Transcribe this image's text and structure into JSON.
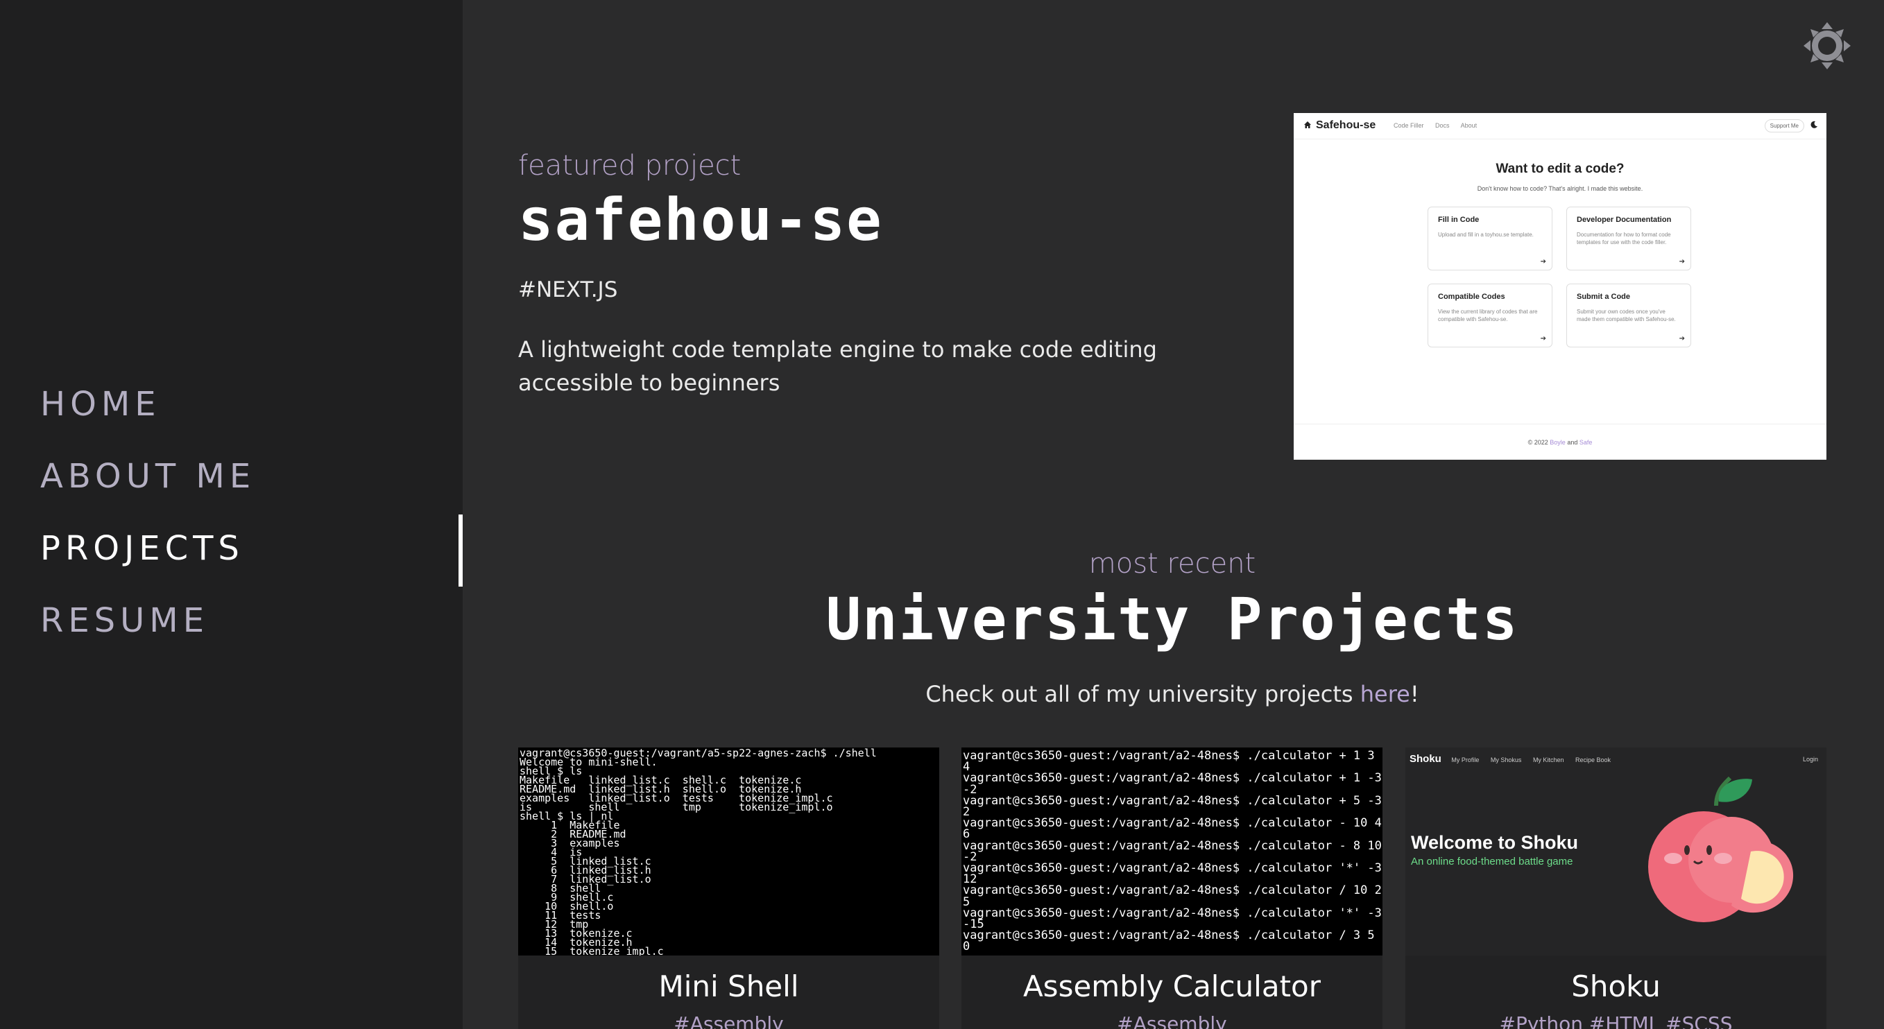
{
  "sidebar": {
    "items": [
      {
        "label": "HOME"
      },
      {
        "label": "ABOUT ME"
      },
      {
        "label": "PROJECTS"
      },
      {
        "label": "RESUME"
      }
    ],
    "active": "PROJECTS"
  },
  "theme_toggle": {
    "icon": "sun-icon"
  },
  "featured": {
    "eyebrow": "featured project",
    "title": "safehou-se",
    "tag": "#NEXT.JS",
    "description": "A lightweight code template engine to make code editing accessible to beginners",
    "screenshot": {
      "brand": "Safehou-se",
      "links": [
        "Code Filler",
        "Docs",
        "About"
      ],
      "support": "Support Me",
      "heading": "Want to edit a code?",
      "sub": "Don't know how to code? That's alright. I made this website.",
      "cards": [
        {
          "title": "Fill in Code",
          "body": "Upload and fill in a toyhou.se template."
        },
        {
          "title": "Developer Documentation",
          "body": "Documentation for how to format code templates for use with the code filler."
        },
        {
          "title": "Compatible Codes",
          "body": "View the current library of codes that are compatible with Safehou-se."
        },
        {
          "title": "Submit a Code",
          "body": "Submit your own codes once you've made them compatible with Safehou-se."
        }
      ],
      "footer_prefix": "© 2022",
      "footer_name1": "Boyle",
      "footer_and": "and",
      "footer_name2": "Safe"
    }
  },
  "recent": {
    "eyebrow": "most recent",
    "title": "University Projects",
    "text_prefix": "Check out all of my university projects ",
    "link": "here",
    "text_suffix": "!"
  },
  "cards": [
    {
      "title": "Mini Shell",
      "tags": "#Assembly",
      "terminal": "vagrant@cs3650-guest:/vagrant/a5-sp22-agnes-zach$ ./shell\nWelcome to mini-shell.\nshell $ ls\nMakefile   linked_list.c  shell.c  tokenize.c\nREADME.md  linked_list.h  shell.o  tokenize.h\nexamples   linked_list.o  tests    tokenize_impl.c\nis         shell          tmp      tokenize_impl.o\nshell $ ls | nl\n     1  Makefile\n     2  README.md\n     3  examples\n     4  is\n     5  linked_list.c\n     6  linked_list.h\n     7  linked_list.o\n     8  shell\n     9  shell.c\n    10  shell.o\n    11  tests\n    12  tmp\n    13  tokenize.c\n    14  tokenize.h\n    15  tokenize_impl.c"
    },
    {
      "title": "Assembly Calculator",
      "tags": "#Assembly",
      "terminal": "vagrant@cs3650-guest:/vagrant/a2-48nes$ ./calculator + 1 3\n4\nvagrant@cs3650-guest:/vagrant/a2-48nes$ ./calculator + 1 -3\n-2\nvagrant@cs3650-guest:/vagrant/a2-48nes$ ./calculator + 5 -3\n2\nvagrant@cs3650-guest:/vagrant/a2-48nes$ ./calculator - 10 4\n6\nvagrant@cs3650-guest:/vagrant/a2-48nes$ ./calculator - 8 10\n-2\nvagrant@cs3650-guest:/vagrant/a2-48nes$ ./calculator '*' -3 -4\n12\nvagrant@cs3650-guest:/vagrant/a2-48nes$ ./calculator / 10 2\n5\nvagrant@cs3650-guest:/vagrant/a2-48nes$ ./calculator '*' -3 5\n-15\nvagrant@cs3650-guest:/vagrant/a2-48nes$ ./calculator / 3 5\n0"
    },
    {
      "title": "Shoku",
      "tags": "#Python #HTML #SCSS",
      "logo": "Shoku",
      "nav": [
        "My Profile",
        "My Shokus",
        "My Kitchen",
        "Recipe Book"
      ],
      "login": "Login",
      "welcome": "Welcome to Shoku",
      "tagline": "An online food-themed battle game"
    }
  ],
  "colors": {
    "background": "#2b2b2c",
    "sidebar": "#1f1f20",
    "accent": "#b3a2c7"
  }
}
